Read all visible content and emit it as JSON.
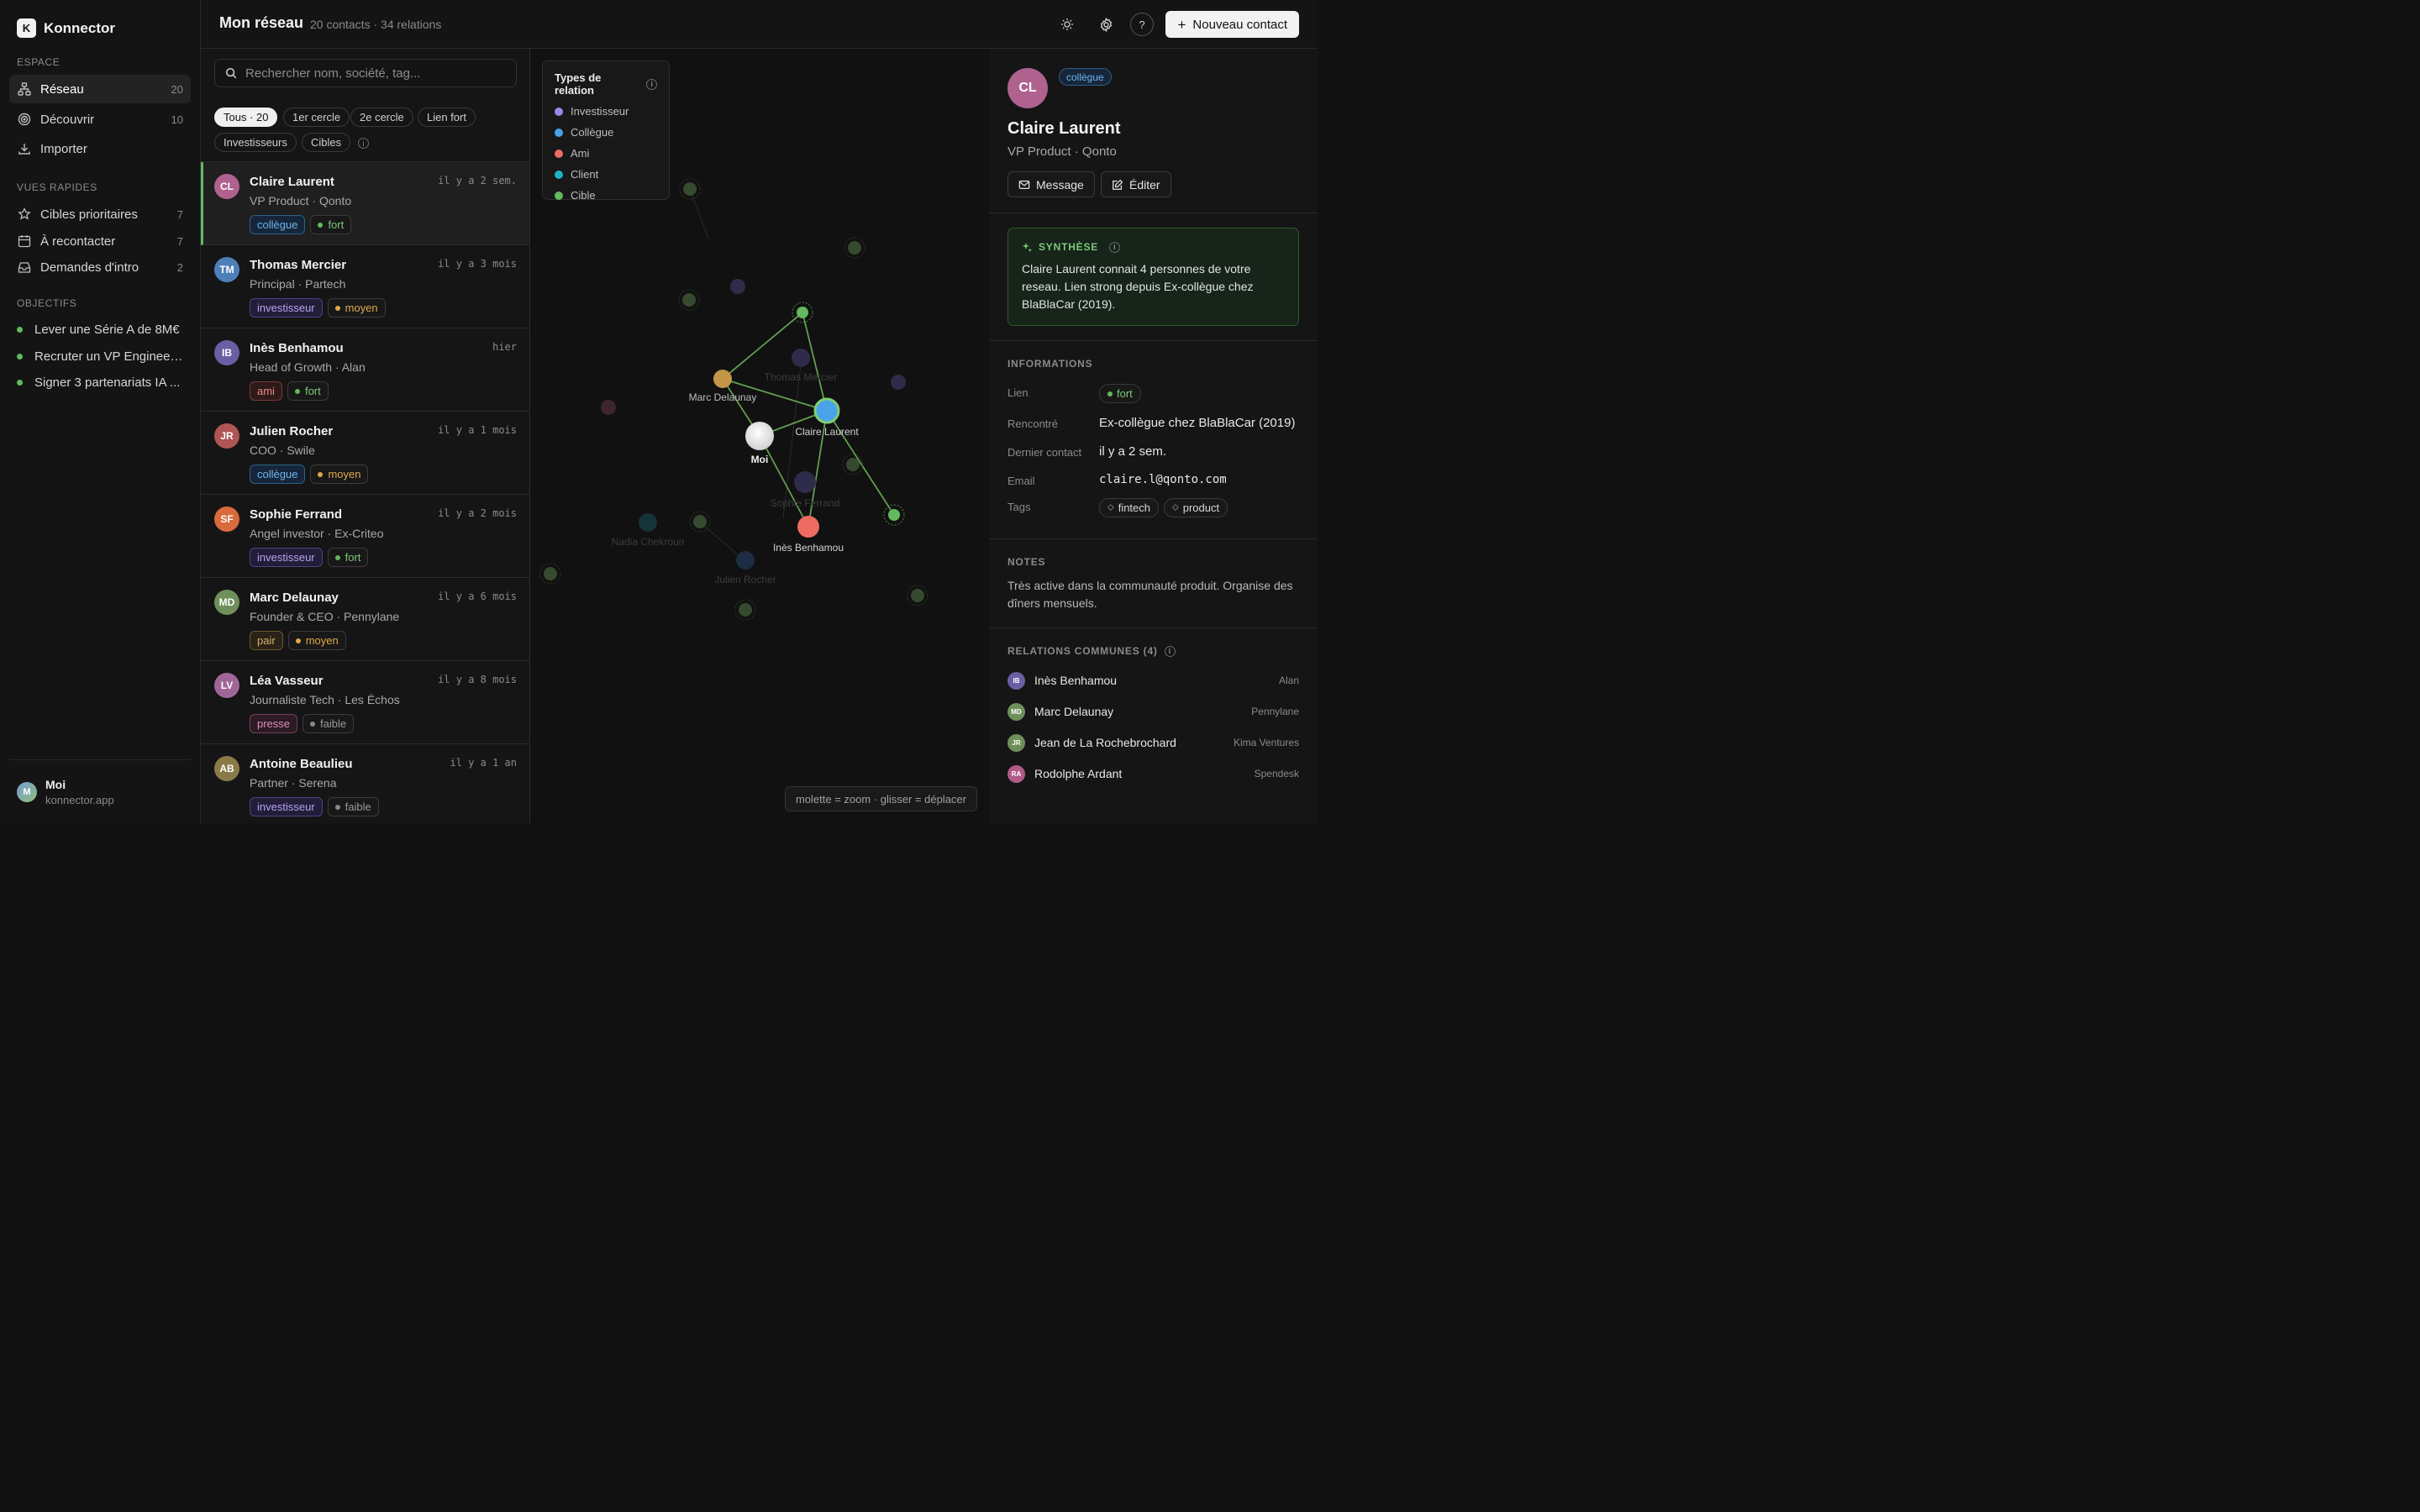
{
  "app": {
    "logo_letter": "K",
    "name": "Konnector"
  },
  "sidebar": {
    "espace_title": "ESPACE",
    "espace": [
      {
        "label": "Réseau",
        "count": "20",
        "icon": "network-icon"
      },
      {
        "label": "Découvrir",
        "count": "10",
        "icon": "target-icon"
      },
      {
        "label": "Importer",
        "count": "",
        "icon": "download-icon"
      }
    ],
    "vues_title": "VUES RAPIDES",
    "vues": [
      {
        "label": "Cibles prioritaires",
        "count": "7",
        "icon": "star-icon"
      },
      {
        "label": "À recontacter",
        "count": "7",
        "icon": "calendar-icon"
      },
      {
        "label": "Demandes d'intro",
        "count": "2",
        "icon": "inbox-icon"
      }
    ],
    "objectifs_title": "OBJECTIFS",
    "objectifs": [
      {
        "label": "Lever une Série A de 8M€"
      },
      {
        "label": "Recruter un VP Engineer..."
      },
      {
        "label": "Signer 3 partenariats IA ..."
      }
    ],
    "user": {
      "initials": "M",
      "name": "Moi",
      "domain": "konnector.app"
    }
  },
  "header": {
    "title": "Mon réseau",
    "subtitle": "20 contacts · 34 relations",
    "new_contact": "Nouveau contact",
    "help": "?"
  },
  "search": {
    "placeholder": "Rechercher nom, société, tag..."
  },
  "filters": [
    {
      "label": "Tous · 20",
      "active": true
    },
    {
      "label": "1er cercle"
    },
    {
      "label": "2e cercle"
    },
    {
      "label": "Lien fort"
    },
    {
      "label": "Investisseurs"
    },
    {
      "label": "Cibles"
    }
  ],
  "contacts": [
    {
      "initials": "CL",
      "name": "Claire Laurent",
      "role": "VP Product · Qonto",
      "time": "il y a 2 sem.",
      "rel": "collègue",
      "relClass": "collegue",
      "strength": "fort",
      "color": "#b0628f"
    },
    {
      "initials": "TM",
      "name": "Thomas Mercier",
      "role": "Principal · Partech",
      "time": "il y a 3 mois",
      "rel": "investisseur",
      "relClass": "investisseur",
      "strength": "moyen",
      "color": "#4f7fb8"
    },
    {
      "initials": "IB",
      "name": "Inès Benhamou",
      "role": "Head of Growth · Alan",
      "time": "hier",
      "rel": "ami",
      "relClass": "ami",
      "strength": "fort",
      "color": "#6b5ea3"
    },
    {
      "initials": "JR",
      "name": "Julien Rocher",
      "role": "COO · Swile",
      "time": "il y a 1 mois",
      "rel": "collègue",
      "relClass": "collegue",
      "strength": "moyen",
      "color": "#b05454"
    },
    {
      "initials": "SF",
      "name": "Sophie Ferrand",
      "role": "Angel investor · Ex-Criteo",
      "time": "il y a 2 mois",
      "rel": "investisseur",
      "relClass": "investisseur",
      "strength": "fort",
      "color": "#d86a3c"
    },
    {
      "initials": "MD",
      "name": "Marc Delaunay",
      "role": "Founder & CEO · Pennylane",
      "time": "il y a 6 mois",
      "rel": "pair",
      "relClass": "pair",
      "strength": "moyen",
      "color": "#6f8f5a"
    },
    {
      "initials": "LV",
      "name": "Léa Vasseur",
      "role": "Journaliste Tech · Les Échos",
      "time": "il y a 8 mois",
      "rel": "presse",
      "relClass": "presse",
      "strength": "faible",
      "color": "#a0669a"
    },
    {
      "initials": "AB",
      "name": "Antoine Beaulieu",
      "role": "Partner · Serena",
      "time": "il y a 1 an",
      "rel": "investisseur",
      "relClass": "investisseur",
      "strength": "faible",
      "color": "#8a7a4a"
    }
  ],
  "graph": {
    "legend_title": "Types de relation",
    "legend": [
      {
        "label": "Investisseur",
        "color": "#9b87e8"
      },
      {
        "label": "Collègue",
        "color": "#4aa3e8"
      },
      {
        "label": "Ami",
        "color": "#ee6b64"
      },
      {
        "label": "Client",
        "color": "#1fb3c2"
      },
      {
        "label": "Cible",
        "color": "#62b95e"
      }
    ],
    "labels": {
      "marc": "Marc Delaunay",
      "claire": "Claire Laurent",
      "moi": "Moi",
      "ines": "Inès Benhamou",
      "thomas": "Thomas Mercier",
      "sophie": "Sophie Ferrand",
      "nadia": "Nadia Chekroun",
      "julien": "Julien Rocher"
    },
    "hint": "molette = zoom · glisser = déplacer"
  },
  "detail": {
    "initials": "CL",
    "badge": "collègue",
    "name": "Claire Laurent",
    "role": "VP Product · Qonto",
    "message_btn": "Message",
    "edit_btn": "Éditer",
    "synth_title": "SYNTHÈSE",
    "synth_text": "Claire Laurent connait 4 personnes de votre reseau. Lien strong depuis Ex-collègue chez BlaBlaCar (2019).",
    "info_title": "INFORMATIONS",
    "info": {
      "lien_key": "Lien",
      "lien_val": "fort",
      "rencontre_key": "Rencontré",
      "rencontre_val": "Ex-collègue chez BlaBlaCar (2019)",
      "dernier_key": "Dernier contact",
      "dernier_val": "il y a 2 sem.",
      "email_key": "Email",
      "email_val": "claire.l@qonto.com",
      "tags_key": "Tags",
      "tag1": "fintech",
      "tag2": "product"
    },
    "notes_title": "NOTES",
    "notes": "Très active dans la communauté produit. Organise des dîners mensuels.",
    "mutual_title": "RELATIONS COMMUNES (4)",
    "mutual": [
      {
        "initials": "IB",
        "name": "Inès Benhamou",
        "company": "Alan",
        "color": "#6b5ea3"
      },
      {
        "initials": "MD",
        "name": "Marc Delaunay",
        "company": "Pennylane",
        "color": "#6f8f5a"
      },
      {
        "initials": "JR",
        "name": "Jean de La Rochebrochard",
        "company": "Kima Ventures",
        "color": "#6f8f5a"
      },
      {
        "initials": "RA",
        "name": "Rodolphe Ardant",
        "company": "Spendesk",
        "color": "#b05a88"
      }
    ]
  }
}
